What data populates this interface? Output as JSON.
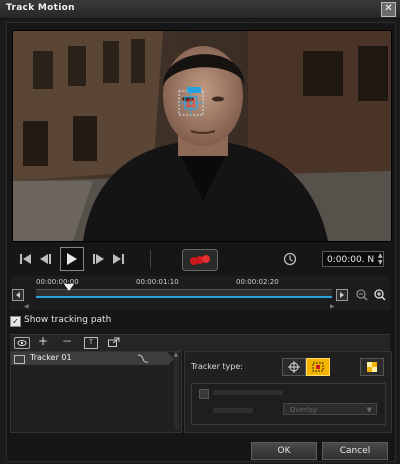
{
  "window": {
    "title": "Track Motion",
    "close_icon": "close-icon"
  },
  "player": {
    "timecode": "0:00:00. N"
  },
  "timeline": {
    "ticks": [
      "00:00:00:00",
      "00:00:01:10",
      "00:00:02:20"
    ]
  },
  "options": {
    "show_tracking_path": "Show tracking path"
  },
  "tracker_list": {
    "items": [
      "Tracker 01"
    ]
  },
  "properties": {
    "tracker_type_label": "Tracker type:",
    "dropdown_value": "Overlay"
  },
  "footer": {
    "ok_label": "OK",
    "cancel_label": "Cancel"
  },
  "colors": {
    "accent_cyan": "#29a3e0",
    "record_red": "#d0181f",
    "active_yellow": "#f2b400"
  }
}
